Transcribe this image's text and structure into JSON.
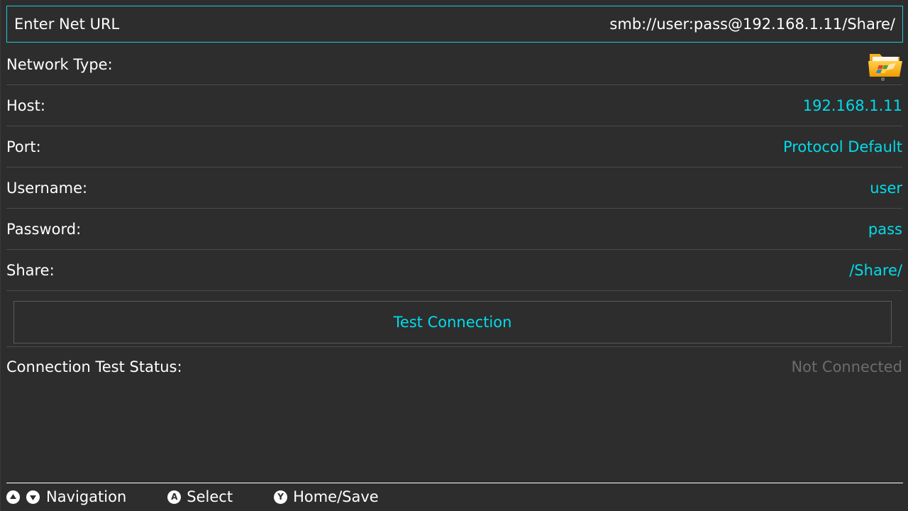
{
  "url_bar": {
    "label": "Enter Net URL",
    "value": "smb://user:pass@192.168.1.11/Share/"
  },
  "fields": [
    {
      "label": "Network Type:",
      "value": "",
      "icon": "network-folder-icon"
    },
    {
      "label": "Host:",
      "value": "192.168.1.11"
    },
    {
      "label": "Port:",
      "value": "Protocol Default"
    },
    {
      "label": "Username:",
      "value": "user"
    },
    {
      "label": "Password:",
      "value": "pass"
    },
    {
      "label": "Share:",
      "value": "/Share/"
    }
  ],
  "test_button": {
    "label": "Test Connection"
  },
  "status": {
    "label": "Connection Test Status:",
    "value": "Not Connected"
  },
  "footer": {
    "navigation": {
      "glyph_up": "up-button-icon",
      "glyph_down": "down-button-icon",
      "label": "Navigation"
    },
    "select": {
      "glyph": "A",
      "label": "Select"
    },
    "home_save": {
      "glyph": "Y",
      "label": "Home/Save"
    }
  },
  "colors": {
    "background": "#2d2d2d",
    "accent": "#00dceb",
    "focus_border": "#21c6d6",
    "muted": "#6c6c6c",
    "text": "#ffffff"
  }
}
